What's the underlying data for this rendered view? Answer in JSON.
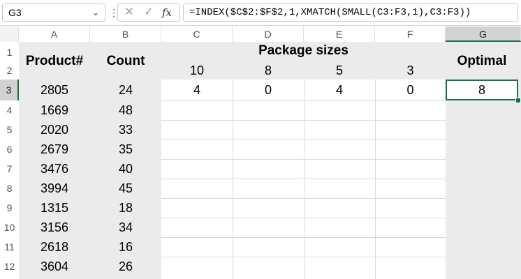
{
  "formula_bar": {
    "name_box": "G3",
    "formula": "=INDEX($C$2:$F$2,1,XMATCH(SMALL(C3:F3,1),C3:F3))",
    "cancel_icon": "close-icon",
    "enter_icon": "check-icon",
    "fx_label": "fx"
  },
  "columns": [
    "A",
    "B",
    "C",
    "D",
    "E",
    "F",
    "G"
  ],
  "rows": [
    "1",
    "2",
    "3",
    "4",
    "5",
    "6",
    "7",
    "8",
    "9",
    "10",
    "11",
    "12"
  ],
  "headers": {
    "product": "Product#",
    "count": "Count",
    "package_sizes": "Package sizes",
    "optimal": "Optimal",
    "sizes": [
      "10",
      "8",
      "5",
      "3"
    ]
  },
  "products": [
    {
      "product": "2805",
      "count": "24"
    },
    {
      "product": "1669",
      "count": "48"
    },
    {
      "product": "2020",
      "count": "33"
    },
    {
      "product": "2679",
      "count": "35"
    },
    {
      "product": "3476",
      "count": "40"
    },
    {
      "product": "3994",
      "count": "45"
    },
    {
      "product": "1315",
      "count": "18"
    },
    {
      "product": "3156",
      "count": "34"
    },
    {
      "product": "2618",
      "count": "16"
    },
    {
      "product": "3604",
      "count": "26"
    }
  ],
  "row3_values": [
    "4",
    "0",
    "4",
    "0"
  ],
  "optimal_value": "8",
  "accent_color": "#1e7145"
}
